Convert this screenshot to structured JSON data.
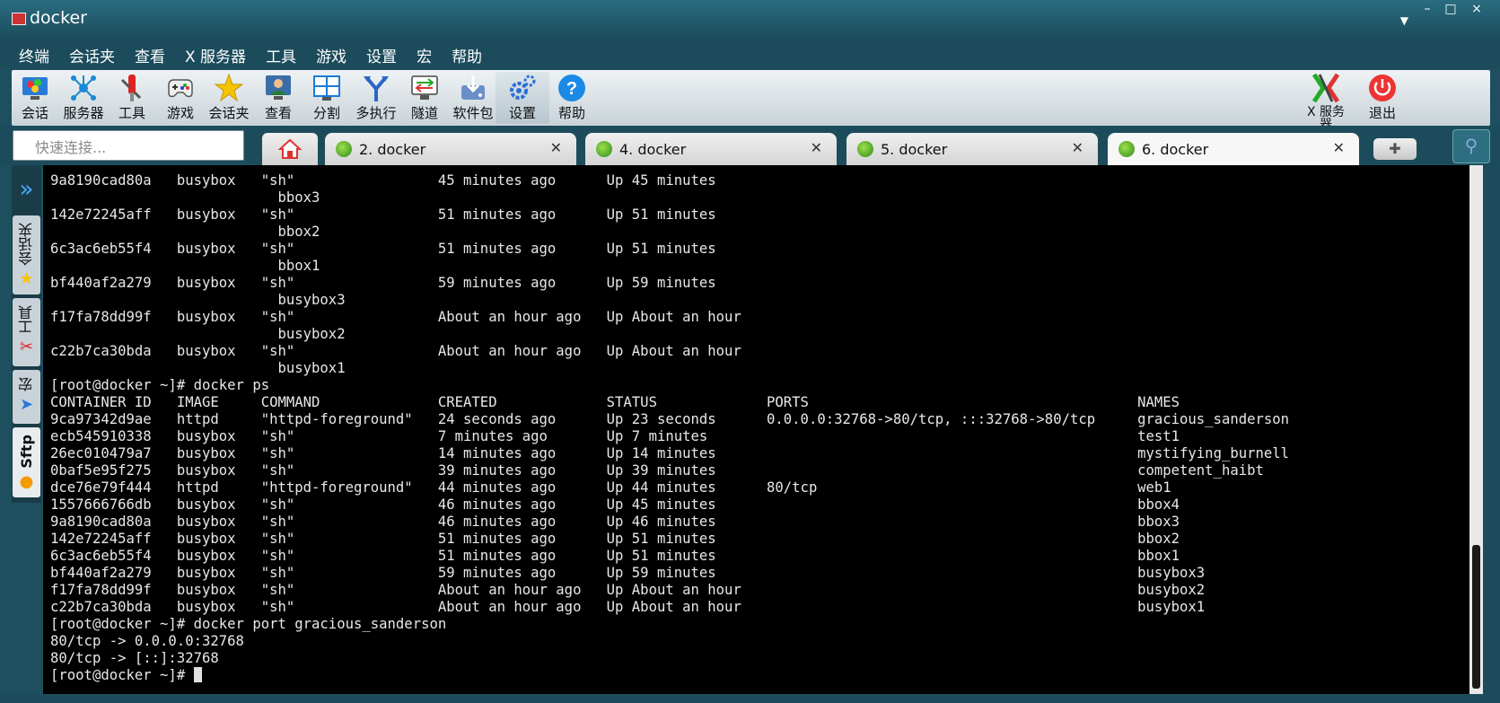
{
  "window": {
    "title": "docker",
    "minimize": "–",
    "maximize": "□",
    "close": "×",
    "dropdown": "▼"
  },
  "menu": [
    "终端",
    "会话夹",
    "查看",
    "X 服务器",
    "工具",
    "游戏",
    "设置",
    "宏",
    "帮助"
  ],
  "toolbar": {
    "items": [
      {
        "label": "会话",
        "icon": "session-icon"
      },
      {
        "label": "服务器",
        "icon": "servers-icon"
      },
      {
        "label": "工具",
        "icon": "tools-icon"
      },
      {
        "label": "游戏",
        "icon": "games-icon"
      },
      {
        "label": "会话夹",
        "icon": "star-icon"
      },
      {
        "label": "查看",
        "icon": "view-icon"
      },
      {
        "label": "分割",
        "icon": "split-icon"
      },
      {
        "label": "多执行",
        "icon": "multiexec-icon"
      },
      {
        "label": "隧道",
        "icon": "tunnel-icon"
      },
      {
        "label": "软件包",
        "icon": "package-icon"
      },
      {
        "label": "设置",
        "icon": "settings-icon"
      },
      {
        "label": "帮助",
        "icon": "help-icon"
      }
    ],
    "xserver_label": "X 服务\n器",
    "exit_label": "退出"
  },
  "quick_connect": {
    "placeholder": "快速连接..."
  },
  "tabs": [
    {
      "label": "2. docker",
      "active": false
    },
    {
      "label": "4. docker",
      "active": false
    },
    {
      "label": "5. docker",
      "active": false
    },
    {
      "label": "6. docker",
      "active": true
    }
  ],
  "add_tab": "✚",
  "sidebar": {
    "tabs": [
      {
        "label": "会话夹",
        "icon": "★"
      },
      {
        "label": "工具",
        "icon": "✂"
      },
      {
        "label": "宏",
        "icon": "➤"
      },
      {
        "label": "Sftp",
        "icon": "●"
      }
    ]
  },
  "terminal": {
    "lines": [
      "9a8190cad80a   busybox   \"sh\"                 45 minutes ago      Up 45 minutes",
      "                           bbox3",
      "142e72245aff   busybox   \"sh\"                 51 minutes ago      Up 51 minutes",
      "                           bbox2",
      "6c3ac6eb55f4   busybox   \"sh\"                 51 minutes ago      Up 51 minutes",
      "                           bbox1",
      "bf440af2a279   busybox   \"sh\"                 59 minutes ago      Up 59 minutes",
      "                           busybox3",
      "f17fa78dd99f   busybox   \"sh\"                 About an hour ago   Up About an hour",
      "                           busybox2",
      "c22b7ca30bda   busybox   \"sh\"                 About an hour ago   Up About an hour",
      "                           busybox1",
      "[root@docker ~]# docker ps",
      "CONTAINER ID   IMAGE     COMMAND              CREATED             STATUS             PORTS                                       NAMES",
      "9ca97342d9ae   httpd     \"httpd-foreground\"   24 seconds ago      Up 23 seconds      0.0.0.0:32768->80/tcp, :::32768->80/tcp     gracious_sanderson",
      "ecb545910338   busybox   \"sh\"                 7 minutes ago       Up 7 minutes                                                   test1",
      "26ec010479a7   busybox   \"sh\"                 14 minutes ago      Up 14 minutes                                                  mystifying_burnell",
      "0baf5e95f275   busybox   \"sh\"                 39 minutes ago      Up 39 minutes                                                  competent_haibt",
      "dce76e79f444   httpd     \"httpd-foreground\"   44 minutes ago      Up 44 minutes      80/tcp                                      web1",
      "1557666766db   busybox   \"sh\"                 46 minutes ago      Up 45 minutes                                                  bbox4",
      "9a8190cad80a   busybox   \"sh\"                 46 minutes ago      Up 46 minutes                                                  bbox3",
      "142e72245aff   busybox   \"sh\"                 51 minutes ago      Up 51 minutes                                                  bbox2",
      "6c3ac6eb55f4   busybox   \"sh\"                 51 minutes ago      Up 51 minutes                                                  bbox1",
      "bf440af2a279   busybox   \"sh\"                 59 minutes ago      Up 59 minutes                                                  busybox3",
      "f17fa78dd99f   busybox   \"sh\"                 About an hour ago   Up About an hour                                               busybox2",
      "c22b7ca30bda   busybox   \"sh\"                 About an hour ago   Up About an hour                                               busybox1",
      "[root@docker ~]# docker port gracious_sanderson",
      "80/tcp -> 0.0.0.0:32768",
      "80/tcp -> [::]:32768"
    ],
    "prompt": "[root@docker ~]# "
  },
  "colors": {
    "chrome": "#1c4c5c",
    "terminal_bg": "#000000",
    "terminal_fg": "#e8e8e8",
    "tab_icon": "#4caf28"
  }
}
